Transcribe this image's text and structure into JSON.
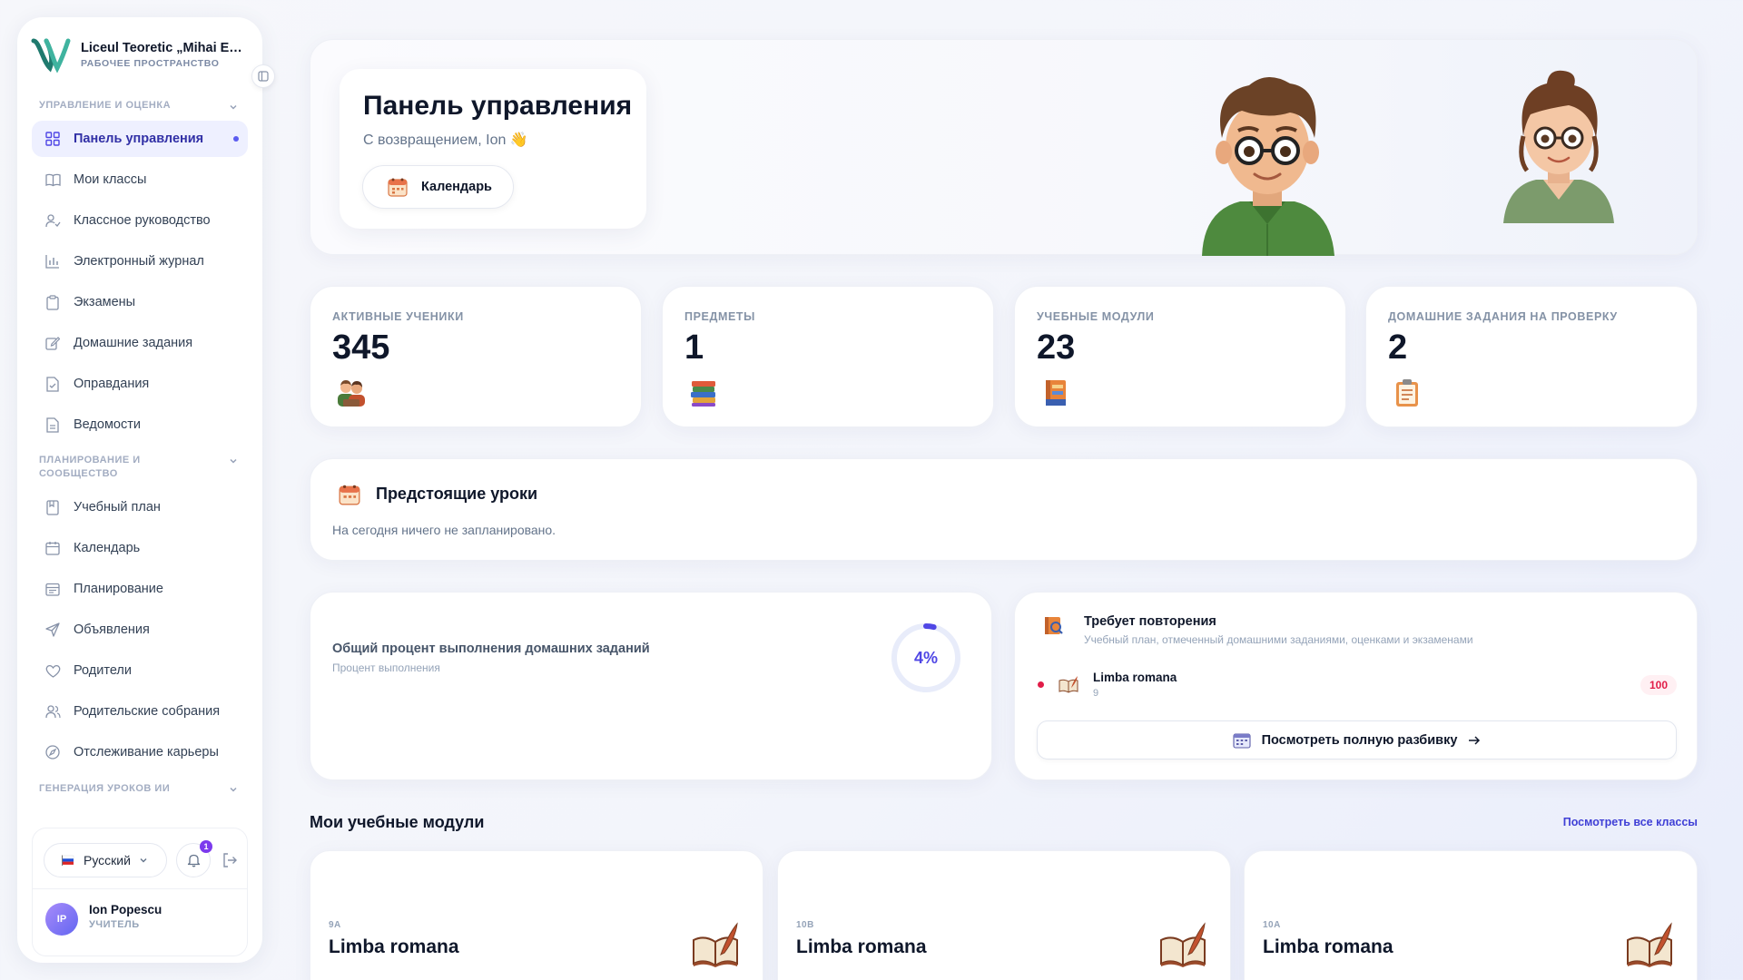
{
  "brand": {
    "name": "Liceul Teoretic „Mihai Emi...",
    "subtitle": "РАБОЧЕЕ ПРОСТРАНСТВО"
  },
  "sidebar": {
    "section1": "УПРАВЛЕНИЕ И ОЦЕНКА",
    "section2": "ПЛАНИРОВАНИЕ И СООБЩЕСТВО",
    "section3": "ГЕНЕРАЦИЯ УРОКОВ ИИ",
    "items": [
      {
        "label": "Панель управления",
        "icon": "dashboard-icon"
      },
      {
        "label": "Мои классы",
        "icon": "book-open-icon"
      },
      {
        "label": "Классное руководство",
        "icon": "user-check-icon"
      },
      {
        "label": "Электронный журнал",
        "icon": "bar-chart-icon"
      },
      {
        "label": "Экзамены",
        "icon": "clipboard-icon"
      },
      {
        "label": "Домашние задания",
        "icon": "edit-icon"
      },
      {
        "label": "Оправдания",
        "icon": "file-check-icon"
      },
      {
        "label": "Ведомости",
        "icon": "file-text-icon"
      },
      {
        "label": "Учебный план",
        "icon": "bookmark-icon"
      },
      {
        "label": "Календарь",
        "icon": "calendar-icon"
      },
      {
        "label": "Планирование",
        "icon": "calendar-lines-icon"
      },
      {
        "label": "Объявления",
        "icon": "send-icon"
      },
      {
        "label": "Родители",
        "icon": "heart-icon"
      },
      {
        "label": "Родительские собрания",
        "icon": "users-icon"
      },
      {
        "label": "Отслеживание карьеры",
        "icon": "compass-icon"
      }
    ],
    "language": "Русский",
    "notifications_count": "1",
    "user": {
      "initials": "IP",
      "name": "Ion Popescu",
      "role": "УЧИТЕЛЬ"
    }
  },
  "hero": {
    "title": "Панель управления",
    "subtitle": "С возвращением, Ion 👋",
    "calendar_button": "Календарь"
  },
  "stats": [
    {
      "label": "АКТИВНЫЕ УЧЕНИКИ",
      "value": "345",
      "icon": "students-icon"
    },
    {
      "label": "ПРЕДМЕТЫ",
      "value": "1",
      "icon": "books-stack-icon"
    },
    {
      "label": "УЧЕБНЫЕ МОДУЛИ",
      "value": "23",
      "icon": "module-book-icon"
    },
    {
      "label": "ДОМАШНИЕ ЗАДАНИЯ НА ПРОВЕРКУ",
      "value": "2",
      "icon": "clipboard-task-icon"
    }
  ],
  "lessons": {
    "title": "Предстоящие уроки",
    "empty": "На сегодня ничего не запланировано."
  },
  "homework": {
    "title": "Общий процент выполнения домашних заданий",
    "subtitle": "Процент выполнения",
    "percent_label": "4%",
    "percent": 4
  },
  "review": {
    "title": "Требует повторения",
    "subtitle": "Учебный план, отмеченный домашними заданиями, оценками и экзаменами",
    "item": {
      "name": "Limba romana",
      "grade": "9",
      "score": "100"
    },
    "button": "Посмотреть полную разбивку"
  },
  "modules": {
    "title": "Мои учебные модули",
    "link": "Посмотреть все классы",
    "items": [
      {
        "class": "9A",
        "name": "Limba romana"
      },
      {
        "class": "10B",
        "name": "Limba romana"
      },
      {
        "class": "10A",
        "name": "Limba romana"
      }
    ]
  },
  "colors": {
    "accent": "#4f46e5",
    "active_bg": "#eef0ff",
    "danger": "#e11d48"
  }
}
